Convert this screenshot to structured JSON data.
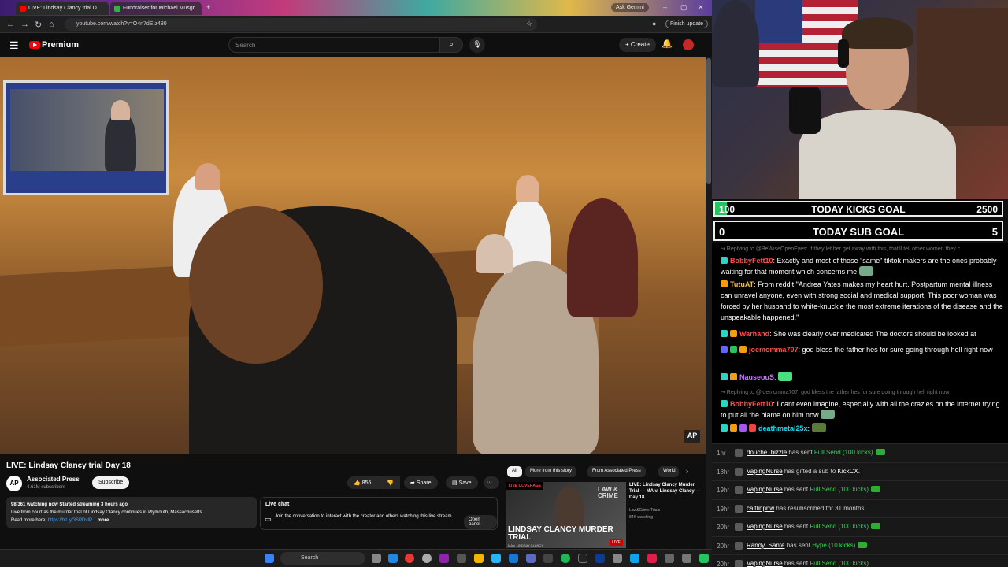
{
  "browser": {
    "tabs": [
      {
        "label": "LIVE: Lindsay Clancy trial D"
      },
      {
        "label": "Fundraiser for Michael Musgr"
      }
    ],
    "ask_gemini": "Ask Gemini",
    "url": "youtube.com/watch?v=O4n7dEIz480",
    "finish_update": "Finish update"
  },
  "youtube": {
    "brand": "Premium",
    "search_placeholder": "Search",
    "create_label": "Create",
    "video": {
      "title": "LIVE: Lindsay Clancy trial Day 18",
      "watermark": "AP"
    },
    "channel": {
      "logo_text": "AP",
      "name": "Associated Press",
      "subscribers": "4.61M subscribers",
      "subscribe_label": "Subscribe"
    },
    "actions": {
      "likes": "855",
      "share": "Share",
      "save": "Save",
      "more": "···"
    },
    "description": {
      "stats": "98,361 watching now  Started streaming 3 hours ago",
      "line1": "Live from court as the murder trial of Lindsay Clancy continues in Plymouth, Massachusetts.",
      "read_more": "Read more here:",
      "link": "https://bit.ly/3SPDvIP",
      "more": "...more"
    },
    "live_chat": {
      "title": "Live chat",
      "text": "Join the conversation to interact with the creator and others watching this live stream.",
      "open_panel": "Open panel"
    },
    "chips": [
      "All",
      "More from this story",
      "From Associated Press",
      "World"
    ],
    "recommendation": {
      "badge": "LIVE COVERAGE",
      "thumb_title": "LINDSAY CLANCY MURDER TRIAL",
      "thumb_brand": "LAW & CRIME",
      "thumb_subtitle": "MA v. LINDSAY CLANCY",
      "live": "LIVE",
      "title": "LIVE: Lindsay Clancy Murder Trial — MA v. Lindsay Clancy — Day 18",
      "channel": "Law&Crime Trials",
      "watching": "84K watching"
    }
  },
  "taskbar": {
    "search_label": "Search"
  },
  "goals": {
    "kicks": {
      "current": "100",
      "title": "TODAY KICKS GOAL",
      "target": "2500",
      "progress": 0.04
    },
    "subs": {
      "current": "0",
      "title": "TODAY SUB GOAL",
      "target": "5"
    }
  },
  "chat": [
    {
      "reply": "↪ Replying to @BeWiseOpenEyes: If they let her get away with this, that'll tell other women they c",
      "user": "BobbyFett10",
      "user_color": "#ff4d4d",
      "text": ": Exactly and most of those \"same\" tiktok makers are the ones probably waiting for that moment which concerns me"
    },
    {
      "user": "TutuAT",
      "user_color": "#f0c040",
      "text": ": From reddit \"Andrea Yates makes my heart hurt. Postpartum mental illness can unravel anyone, even with strong social and medical support. This poor woman was forced by her husband to white-knuckle the most extreme iterations of the disease and the unspeakable happened.\""
    },
    {
      "user": "Warhand",
      "user_color": "#ff4d4d",
      "text": ": She was clearly over medicated The doctors should be looked at"
    },
    {
      "user": "joemomma707",
      "user_color": "#ff4d4d",
      "text": ": god bless the father hes for sure going through hell right now"
    },
    {
      "user": "NauseouS",
      "user_color": "#c77dff",
      "text": ":"
    },
    {
      "reply": "↪ Replying to @joemomma707: god bless the father hes for sure going through hell right now",
      "user": "BobbyFett10",
      "user_color": "#ff4d4d",
      "text": ": I cant even imagine, especially with all the crazies on the internet trying to put all the blame on him now"
    },
    {
      "user": "deathmetal25x",
      "user_color": "#00e5ff",
      "text": ":"
    }
  ],
  "feed": [
    {
      "time": "1hr",
      "user": "douche_bizzle",
      "action": "has sent",
      "item": "Full Send (100 kicks)"
    },
    {
      "time": "18hr",
      "user": "VapingNurse",
      "action": "has gifted a sub to",
      "item": "KickCX."
    },
    {
      "time": "19hr",
      "user": "VapingNurse",
      "action": "has sent",
      "item": "Full Send (100 kicks)"
    },
    {
      "time": "19hr",
      "user": "caitlinpnw",
      "action": "has resubscribed for 31 months",
      "item": ""
    },
    {
      "time": "20hr",
      "user": "VapingNurse",
      "action": "has sent",
      "item": "Full Send (100 kicks)"
    },
    {
      "time": "20hr",
      "user": "Randy_Sante",
      "action": "has sent",
      "item": "Hype (10 kicks)"
    },
    {
      "time": "20hr",
      "user": "VapingNurse",
      "action": "has sent",
      "item": "Full Send (100 kicks)"
    }
  ]
}
